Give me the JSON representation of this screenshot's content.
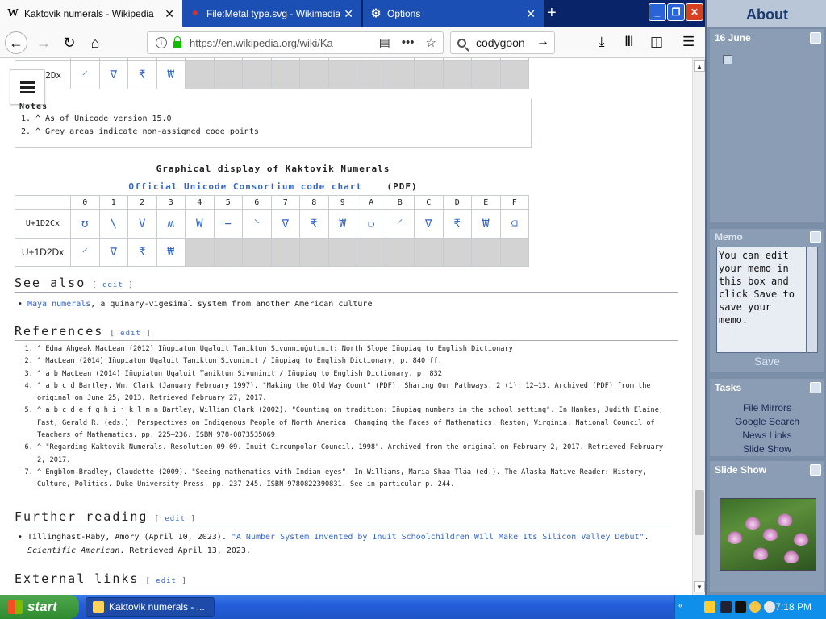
{
  "tabs": [
    {
      "label": "Kaktovik numerals - Wikipedia",
      "icon": "W"
    },
    {
      "label": "File:Metal type.svg - Wikimedia Co",
      "icon": "commons"
    },
    {
      "label": "Options",
      "icon": "gear"
    }
  ],
  "nav": {
    "url": "https://en.wikipedia.org/wiki/Ka",
    "search_value": "codygoon"
  },
  "table1": {
    "label": "U+1D2Dx",
    "glyphs": [
      "⸍",
      "∇",
      "₹",
      "₩"
    ],
    "gray_count": 12
  },
  "notes": {
    "title": "Notes",
    "items": [
      "^ As of Unicode version 15.0",
      "^ Grey areas indicate non-assigned code points"
    ]
  },
  "graphical": {
    "title": "Graphical display of Kaktovik Numerals",
    "link": "Official Unicode Consortium code chart",
    "pdf": "(PDF)",
    "headers": [
      "0",
      "1",
      "2",
      "3",
      "4",
      "5",
      "6",
      "7",
      "8",
      "9",
      "A",
      "B",
      "C",
      "D",
      "E",
      "F"
    ],
    "row1_label": "U+1D2Cx",
    "row1": [
      "ʊ",
      "\\",
      "V",
      "ʍ",
      "W",
      "−",
      "⸌",
      "∇",
      "₹",
      "₩",
      "⫐",
      "⸍",
      "∇",
      "₹",
      "₩",
      "⫑"
    ],
    "row2_label": "U+1D2Dx",
    "row2": [
      "⸍",
      "∇",
      "₹",
      "₩"
    ]
  },
  "see_also": {
    "heading": "See also",
    "edit": "edit",
    "link": "Maya numerals",
    "text": ", a quinary-vigesimal system from another American culture"
  },
  "references": {
    "heading": "References",
    "edit": "edit",
    "items": [
      "^ Edna Ahgeak MacLean (2012) Iñupiatun Uqaluit Taniktun Sivunniuġutinit: North Slope Iñupiaq to English Dictionary",
      "^ MacLean (2014) Iñupiatun Uqaluit Taniktun Sivuninit / Iñupiaq to English Dictionary, p. 840 ff.",
      "^ a b MacLean (2014) Iñupiatun Uqaluit Taniktun Sivuninit / Iñupiaq to English Dictionary, p. 832",
      "^ a b c d Bartley, Wm. Clark (January February 1997). \"Making the Old Way Count\" (PDF). Sharing Our Pathways. 2 (1): 12–13. Archived (PDF) from the original on June 25, 2013. Retrieved February 27, 2017.",
      "^ a b c d e f g h i j k l m n Bartley, William Clark (2002). \"Counting on tradition: Iñupiaq numbers in the school setting\". In Hankes, Judith Elaine; Fast, Gerald R. (eds.). Perspectives on Indigenous People of North America. Changing the Faces of Mathematics. Reston, Virginia: National Council of Teachers of Mathematics. pp. 225–236. ISBN 978-0873535069.",
      "^ \"Regarding Kaktovik Numerals. Resolution 09-09. Inuit Circumpolar Council. 1998\". Archived from the original on February 2, 2017. Retrieved February 2, 2017.",
      "^ Engblom-Bradley, Claudette (2009). \"Seeing mathematics with Indian eyes\". In Williams, Maria Shaa Tláa (ed.). The Alaska Native Reader: History, Culture, Politics. Duke University Press. pp. 237–245. ISBN 9780822390831. See in particular p. 244."
    ]
  },
  "further": {
    "heading": "Further reading",
    "edit": "edit",
    "author": "Tillinghast-Raby, Amory (April 10, 2023). ",
    "link": "\"A Number System Invented by Inuit Schoolchildren Will Make Its Silicon Valley Debut\"",
    "source": "Scientific American",
    "tail": ". Retrieved April 13, 2023."
  },
  "external": {
    "heading": "External links",
    "edit": "edit"
  },
  "panel": {
    "title": "About",
    "date": "16 June",
    "memo_heading": "Memo",
    "memo_text": "You can edit your memo in this box and click Save to save your memo.",
    "save": "Save",
    "tasks_heading": "Tasks",
    "tasks": [
      "File Mirrors",
      "Google Search",
      "News Links",
      "Slide Show"
    ],
    "slideshow_heading": "Slide Show"
  },
  "taskbar": {
    "start": "start",
    "item": "Kaktovik numerals - ...",
    "time": "7:18 PM"
  },
  "colors": {
    "link": "#3366cc",
    "gray_cell": "#d3d3d3",
    "titlebar": "#0a246a",
    "panel": "#7a8ea8"
  }
}
